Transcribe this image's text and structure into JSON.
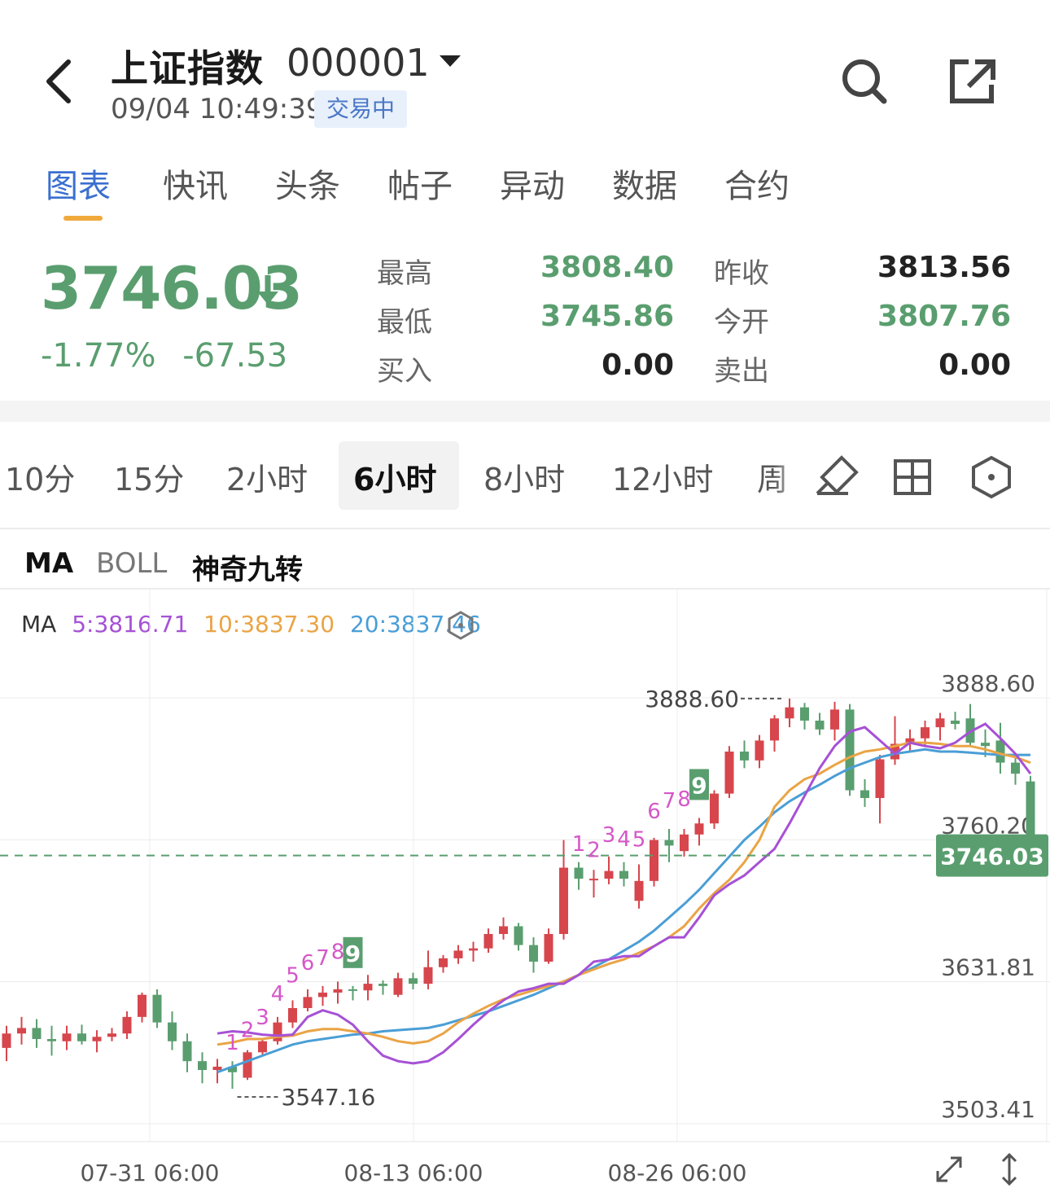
{
  "header": {
    "name": "上证指数",
    "code": "000001",
    "datetime": "09/04 10:49:39",
    "status": "交易中"
  },
  "tabs": [
    {
      "label": "图表",
      "active": true
    },
    {
      "label": "快讯"
    },
    {
      "label": "头条"
    },
    {
      "label": "帖子"
    },
    {
      "label": "异动"
    },
    {
      "label": "数据"
    },
    {
      "label": "合约"
    }
  ],
  "quote": {
    "price": "3746.03",
    "change_pct": "-1.77%",
    "change_abs": "-67.53",
    "high_label": "最高",
    "high": "3808.40",
    "low_label": "最低",
    "low": "3745.86",
    "bid_label": "买入",
    "bid": "0.00",
    "prev_close_label": "昨收",
    "prev_close": "3813.56",
    "open_label": "今开",
    "open": "3807.76",
    "ask_label": "卖出",
    "ask": "0.00"
  },
  "colors": {
    "down": "#5a9e6f",
    "up": "#d6464c",
    "ma5": "#a651d6",
    "ma10": "#eaa445",
    "ma20": "#4a9ed6",
    "accent": "#3a6fd0"
  },
  "periods": [
    {
      "label": "10分"
    },
    {
      "label": "15分"
    },
    {
      "label": "2小时"
    },
    {
      "label": "6小时",
      "active": true
    },
    {
      "label": "8小时"
    },
    {
      "label": "12小时"
    },
    {
      "label": "周"
    }
  ],
  "indicators": [
    {
      "label": "MA",
      "active": true
    },
    {
      "label": "BOLL",
      "active": false
    },
    {
      "label": "神奇九转",
      "active": true
    }
  ],
  "ma_legend": {
    "prefix": "MA",
    "ma5": "5:3816.71",
    "ma10": "10:3837.30",
    "ma20": "20:3837.46"
  },
  "chart_data": {
    "type": "candlestick",
    "y_ticks": [
      "3888.60",
      "3760.20",
      "3631.81",
      "3503.41"
    ],
    "ylim": [
      3503.41,
      3888.6
    ],
    "x_ticks": [
      "07-31 06:00",
      "08-13 06:00",
      "08-26 06:00"
    ],
    "high_label": "3888.60",
    "low_label": "3547.16",
    "last_price_label": "3746.03",
    "last_price": 3746.03,
    "nine_turn_up_1": [
      "1",
      "2",
      "3",
      "4",
      "5",
      "6",
      "7",
      "8",
      "9"
    ],
    "nine_turn_up_2": [
      "1",
      "2",
      "3",
      "4",
      "5",
      "6",
      "7",
      "8",
      "9"
    ],
    "candles": [
      [
        3572,
        3592,
        3560,
        3585
      ],
      [
        3585,
        3600,
        3575,
        3590
      ],
      [
        3590,
        3598,
        3572,
        3580
      ],
      [
        3580,
        3592,
        3565,
        3578
      ],
      [
        3578,
        3592,
        3570,
        3585
      ],
      [
        3585,
        3593,
        3575,
        3578
      ],
      [
        3578,
        3588,
        3568,
        3582
      ],
      [
        3582,
        3590,
        3578,
        3585
      ],
      [
        3585,
        3605,
        3580,
        3600
      ],
      [
        3600,
        3622,
        3595,
        3620
      ],
      [
        3620,
        3625,
        3590,
        3595
      ],
      [
        3595,
        3605,
        3570,
        3578
      ],
      [
        3578,
        3585,
        3550,
        3560
      ],
      [
        3560,
        3568,
        3540,
        3552
      ],
      [
        3552,
        3562,
        3540,
        3555
      ],
      [
        3555,
        3560,
        3535,
        3550
      ],
      [
        3545,
        3570,
        3543,
        3568
      ],
      [
        3568,
        3580,
        3565,
        3578
      ],
      [
        3578,
        3600,
        3575,
        3595
      ],
      [
        3595,
        3615,
        3590,
        3608
      ],
      [
        3608,
        3625,
        3605,
        3618
      ],
      [
        3618,
        3628,
        3610,
        3622
      ],
      [
        3622,
        3632,
        3612,
        3625
      ],
      [
        3625,
        3628,
        3615,
        3624
      ],
      [
        3624,
        3638,
        3615,
        3630
      ],
      [
        3630,
        3633,
        3620,
        3628
      ],
      [
        3620,
        3640,
        3618,
        3635
      ],
      [
        3635,
        3640,
        3625,
        3630
      ],
      [
        3630,
        3660,
        3625,
        3645
      ],
      [
        3645,
        3656,
        3640,
        3653
      ],
      [
        3653,
        3665,
        3648,
        3660
      ],
      [
        3660,
        3668,
        3650,
        3662
      ],
      [
        3662,
        3680,
        3658,
        3675
      ],
      [
        3675,
        3690,
        3670,
        3682
      ],
      [
        3682,
        3685,
        3660,
        3665
      ],
      [
        3665,
        3672,
        3640,
        3650
      ],
      [
        3650,
        3680,
        3648,
        3675
      ],
      [
        3675,
        3760,
        3670,
        3735
      ],
      [
        3735,
        3740,
        3715,
        3725
      ],
      [
        3725,
        3733,
        3708,
        3725
      ],
      [
        3725,
        3745,
        3720,
        3732
      ],
      [
        3732,
        3740,
        3718,
        3725
      ],
      [
        3705,
        3738,
        3698,
        3723
      ],
      [
        3723,
        3762,
        3718,
        3760
      ],
      [
        3760,
        3770,
        3740,
        3755
      ],
      [
        3750,
        3770,
        3745,
        3765
      ],
      [
        3765,
        3780,
        3755,
        3775
      ],
      [
        3775,
        3805,
        3770,
        3802
      ],
      [
        3802,
        3845,
        3798,
        3840
      ],
      [
        3840,
        3850,
        3825,
        3832
      ],
      [
        3832,
        3855,
        3825,
        3850
      ],
      [
        3850,
        3873,
        3840,
        3870
      ],
      [
        3870,
        3888,
        3862,
        3880
      ],
      [
        3880,
        3884,
        3860,
        3868
      ],
      [
        3868,
        3875,
        3855,
        3860
      ],
      [
        3860,
        3885,
        3850,
        3878
      ],
      [
        3878,
        3883,
        3800,
        3805
      ],
      [
        3805,
        3815,
        3790,
        3798
      ],
      [
        3798,
        3837,
        3775,
        3833
      ],
      [
        3833,
        3872,
        3828,
        3847
      ],
      [
        3847,
        3860,
        3840,
        3852
      ],
      [
        3852,
        3868,
        3845,
        3862
      ],
      [
        3862,
        3875,
        3850,
        3870
      ],
      [
        3868,
        3876,
        3860,
        3865
      ],
      [
        3870,
        3883,
        3845,
        3848
      ],
      [
        3848,
        3860,
        3835,
        3845
      ],
      [
        3850,
        3866,
        3820,
        3830
      ],
      [
        3830,
        3835,
        3810,
        3820
      ],
      [
        3813,
        3818,
        3745,
        3746
      ]
    ],
    "ma5": [
      3585,
      3587,
      3586,
      3584,
      3583,
      3584,
      3600,
      3606,
      3602,
      3593,
      3578,
      3565,
      3560,
      3558,
      3560,
      3568,
      3580,
      3593,
      3605,
      3615,
      3623,
      3626,
      3630,
      3630,
      3638,
      3650,
      3652,
      3655,
      3655,
      3664,
      3672,
      3672,
      3690,
      3710,
      3720,
      3728,
      3740,
      3752,
      3775,
      3800,
      3825,
      3845,
      3858,
      3862,
      3850,
      3838,
      3848,
      3845,
      3843,
      3848,
      3858,
      3865,
      3852,
      3838,
      3820
    ],
    "ma10": [
      3575,
      3577,
      3580,
      3580,
      3582,
      3583,
      3587,
      3589,
      3589,
      3587,
      3585,
      3582,
      3578,
      3576,
      3578,
      3585,
      3595,
      3603,
      3610,
      3616,
      3620,
      3624,
      3628,
      3632,
      3638,
      3643,
      3648,
      3652,
      3658,
      3664,
      3672,
      3682,
      3698,
      3712,
      3724,
      3740,
      3760,
      3790,
      3805,
      3815,
      3820,
      3828,
      3835,
      3840,
      3842,
      3845,
      3848,
      3848,
      3847,
      3845,
      3845,
      3842,
      3838,
      3835,
      3830
    ],
    "ma20": [
      3550,
      3555,
      3560,
      3565,
      3570,
      3575,
      3578,
      3580,
      3582,
      3584,
      3585,
      3587,
      3588,
      3589,
      3590,
      3593,
      3597,
      3601,
      3605,
      3610,
      3615,
      3620,
      3626,
      3632,
      3638,
      3645,
      3652,
      3660,
      3668,
      3678,
      3690,
      3702,
      3715,
      3730,
      3745,
      3760,
      3772,
      3785,
      3795,
      3803,
      3810,
      3818,
      3825,
      3830,
      3835,
      3838,
      3840,
      3842,
      3840,
      3840,
      3839,
      3838,
      3837,
      3837,
      3837
    ]
  }
}
